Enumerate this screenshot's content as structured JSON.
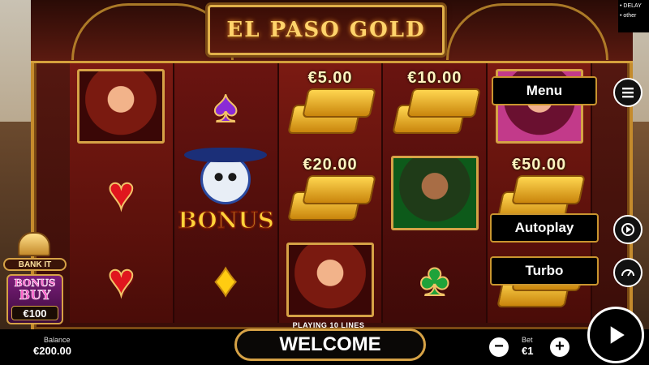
{
  "game": {
    "title": "EL PASO GOLD"
  },
  "reels": [
    [
      {
        "type": "portrait",
        "name": "redhead-woman"
      },
      {
        "type": "suit",
        "name": "heart"
      },
      {
        "type": "suit",
        "name": "heart"
      }
    ],
    [
      {
        "type": "suit",
        "name": "spade"
      },
      {
        "type": "bonus",
        "label": "BONUS"
      },
      {
        "type": "suit",
        "name": "diamond"
      }
    ],
    [
      {
        "type": "gold",
        "value": "€5.00"
      },
      {
        "type": "gold",
        "value": "€20.00"
      },
      {
        "type": "portrait",
        "name": "woman-red-hat"
      }
    ],
    [
      {
        "type": "gold",
        "value": "€10.00"
      },
      {
        "type": "portrait",
        "name": "woman-green"
      },
      {
        "type": "suit",
        "name": "club"
      }
    ],
    [
      {
        "type": "portrait",
        "name": "woman-pink"
      },
      {
        "type": "gold",
        "value": "€50.00"
      },
      {
        "type": "gold",
        "value": ""
      }
    ]
  ],
  "side_menu": {
    "menu_label": "Menu",
    "autoplay_label": "Autoplay",
    "turbo_label": "Turbo"
  },
  "bonus_buy": {
    "bank_label": "BANK IT",
    "title_line1": "BONUS",
    "title_line2": "BUY",
    "price": "€100"
  },
  "footer": {
    "playing_lines": "PLAYING 10 LINES",
    "message": "WELCOME",
    "balance_label": "Balance",
    "balance_value": "€200.00",
    "bet_label": "Bet",
    "bet_value": "€1",
    "minus": "−",
    "plus": "+"
  },
  "debug_overlay": {
    "line1": "• DELAY",
    "line2": "• other"
  },
  "colors": {
    "frame_gold": "#d6a246",
    "reel_red": "#6a1410",
    "accent_yellow": "#ffd36b"
  }
}
